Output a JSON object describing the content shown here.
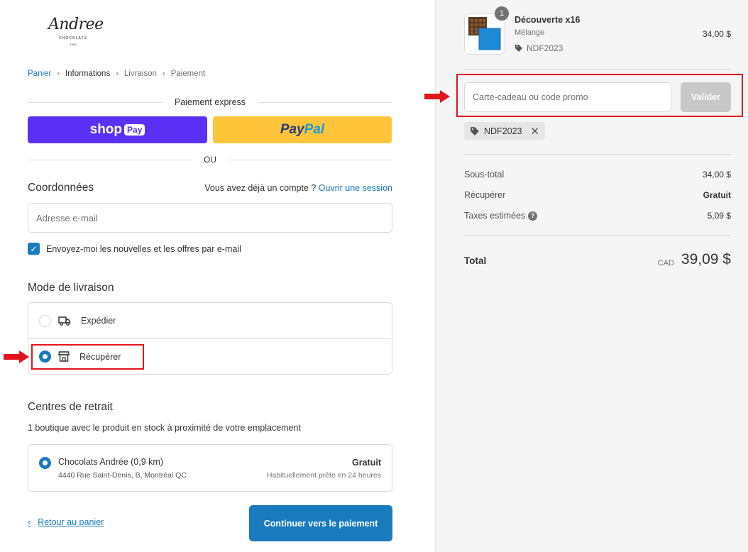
{
  "brand": {
    "name": "Andree",
    "subtitle": "CHOCOLATS",
    "year": "1940"
  },
  "breadcrumb": {
    "items": [
      "Panier",
      "Informations",
      "Livraison",
      "Paiement"
    ]
  },
  "express": {
    "title": "Paiement express",
    "shoppay_label": "shop",
    "shoppay_pill": "Pay",
    "paypal_part1": "Pay",
    "paypal_part2": "Pal",
    "or_label": "OU"
  },
  "contact": {
    "title": "Coordonnées",
    "account_prompt": "Vous avez déjà un compte ?",
    "login_link": "Ouvrir une session",
    "email_placeholder": "Adresse e-mail",
    "newsletter_label": "Envoyez-moi les nouvelles et les offres par e-mail",
    "newsletter_checked": true
  },
  "delivery": {
    "title": "Mode de livraison",
    "options": [
      {
        "label": "Expédier",
        "icon": "truck-icon",
        "selected": false
      },
      {
        "label": "Récupérer",
        "icon": "store-icon",
        "selected": true
      }
    ]
  },
  "pickup": {
    "title": "Centres de retrait",
    "description": "1 boutique avec le produit en stock à proximité de votre emplacement",
    "store_name": "Chocolats Andrée (0,9 km)",
    "store_address": "4440 Rue Saint-Denis, B, Montréal QC",
    "store_price": "Gratuit",
    "store_ready": "Habituellement prête en 24 heures"
  },
  "footer": {
    "back_label": "Retour au panier",
    "continue_label": "Continuer vers le paiement"
  },
  "cart": {
    "item": {
      "quantity": "1",
      "name": "Découverte x16",
      "variant": "Mélange",
      "discount_code": "NDF2023",
      "price": "34,00 $"
    },
    "promo": {
      "placeholder": "Carte-cadeau ou code promo",
      "button_label": "Valider",
      "applied_code": "NDF2023"
    },
    "summary": {
      "subtotal_label": "Sous-total",
      "subtotal_value": "34,00 $",
      "pickup_label": "Récupérer",
      "pickup_value": "Gratuit",
      "taxes_label": "Taxes estimées",
      "taxes_value": "5,09 $",
      "total_label": "Total",
      "currency": "CAD",
      "total_value": "39,09 $"
    }
  },
  "colors": {
    "accent": "#197bbd",
    "shoppay": "#5a31f4",
    "paypal": "#ffc439",
    "highlight": "#e3141d"
  }
}
